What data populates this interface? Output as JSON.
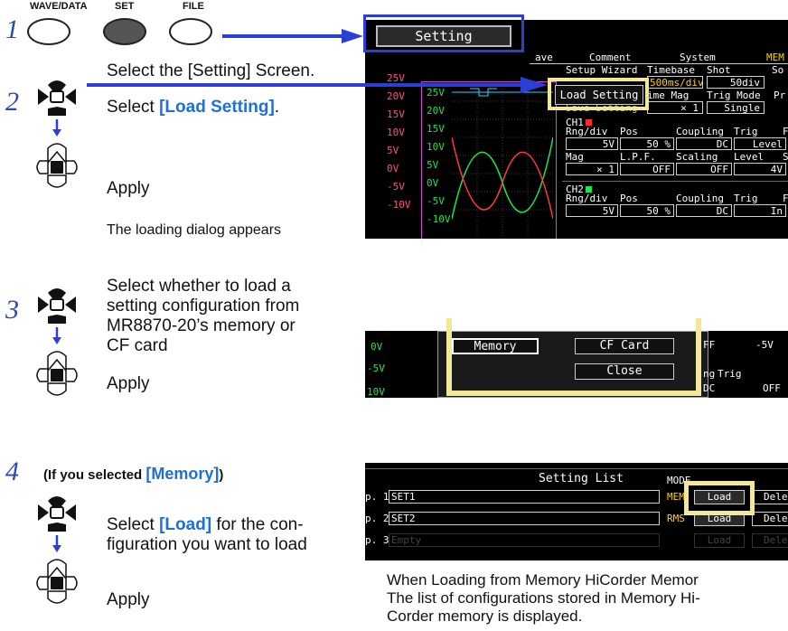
{
  "hw_buttons": {
    "wave_data": "WAVE/DATA",
    "set": "SET",
    "file": "FILE"
  },
  "steps": [
    {
      "num": "1",
      "text": "Select the [Setting] Screen."
    },
    {
      "num": "2",
      "pre": "Select ",
      "highlight": "[Load Setting]",
      "post": ".",
      "apply": "Apply",
      "note": "The loading dialog appears"
    },
    {
      "num": "3",
      "text_lines": [
        "Select whether to load a",
        "setting configuration from",
        "MR8870-20’s memory or",
        "CF card"
      ],
      "apply": "Apply"
    },
    {
      "num": "4",
      "cond_pre": "(If you selected ",
      "cond_highlight": "[Memory]",
      "cond_post": ")",
      "pre": "Select ",
      "highlight": "[Load]",
      "post_line1": " for the con-",
      "line2": "figuration you want to load",
      "apply": "Apply"
    }
  ],
  "screen1": {
    "tab_setting": "Setting",
    "tabs": [
      "ave",
      "Comment",
      "System",
      "MEM"
    ],
    "labels": {
      "setup_wizard": "Setup Wizard",
      "timebase": "Timebase",
      "shot": "Shot",
      "so": "So",
      "timebase_val": "500ms/div",
      "shot_val": "50div",
      "time_mag": "ime Mag",
      "trig_mode": "Trig Mode",
      "pr": "Pr",
      "time_mag_val": "× 1",
      "trig_mode_val": "Single",
      "save_setting": "Save Setting",
      "load_setting": "Load Setting",
      "ch1": "CH1",
      "rng_div": "Rng/div",
      "pos": "Pos",
      "coupling": "Coupling",
      "trig": "Trig",
      "f": "F",
      "rng_val": "5V",
      "pos_val": "50 %",
      "coupling_val": "DC",
      "trig_val": "Level",
      "mag": "Mag",
      "lpf": "L.P.F.",
      "scaling": "Scaling",
      "level": "Level",
      "s": "S",
      "mag_val": "× 1",
      "lpf_val": "OFF",
      "scaling_val": "OFF",
      "level_val": "4V",
      "ch2": "CH2",
      "ch2_rng_val": "5V",
      "ch2_pos_val": "50 %",
      "ch2_coupling_val": "DC",
      "ch2_trig_val": "In"
    },
    "y_outer": [
      "25V",
      "20V",
      "15V",
      "10V",
      "5V",
      "0V",
      "-5V",
      "-10V"
    ],
    "y_inner": [
      "25V",
      "20V",
      "15V",
      "10V",
      "5V",
      "0V",
      "-5V",
      "-10V"
    ]
  },
  "screen2": {
    "memory": "Memory",
    "cf_card": "CF Card",
    "close": "Close",
    "ff": "FF",
    "neg5v": "-5V",
    "zero": "0V",
    "neg5": "-5V",
    "neg10": "10V",
    "ng": "ng",
    "trig": "Trig",
    "dc": "DC",
    "off": "OFF"
  },
  "screen3": {
    "title": "Setting List",
    "mode": "MODE",
    "rows": [
      {
        "no": "p. 1",
        "name": "SET1",
        "mode": "MEM",
        "load": "Load",
        "del": "Dele"
      },
      {
        "no": "p. 2",
        "name": "SET2",
        "mode": "RMS",
        "load": "Load",
        "del": "Dele"
      },
      {
        "no": "p. 3",
        "name": "Empty",
        "mode": "",
        "load": "Load",
        "del": "Dele"
      }
    ]
  },
  "caption": {
    "line1": "When Loading from Memory HiCorder Memor",
    "line2": "The list of configurations stored in Memory Hi-",
    "line3": "Corder memory is displayed."
  },
  "colors": {
    "arrow": "#2a3fd6",
    "frame": "#2a3fd6",
    "highlight": "#f3e89a",
    "step": "#2c47b8",
    "accent": "#1e6fd9"
  }
}
